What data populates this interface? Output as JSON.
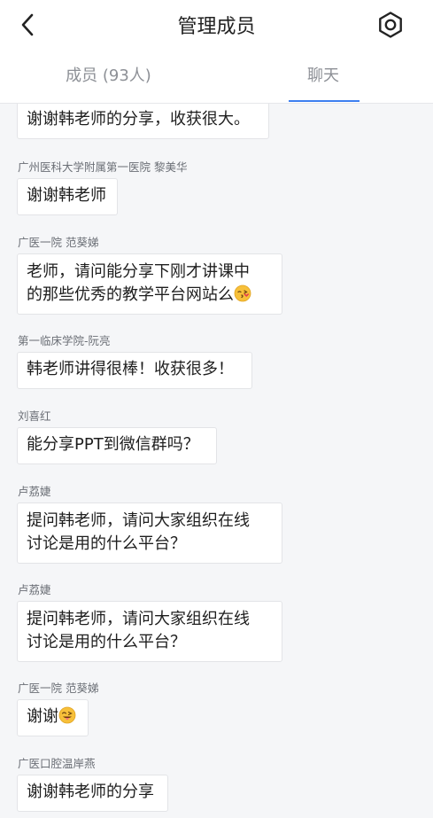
{
  "header": {
    "title": "管理成员",
    "back_icon": "chevron-left-icon",
    "settings_icon": "gear-icon"
  },
  "tabs": [
    {
      "label": "成员 (93人)",
      "active": false
    },
    {
      "label": "聊天",
      "active": true
    }
  ],
  "colors": {
    "accent": "#3d7ff0",
    "background": "#f5f6f8",
    "bubble_bg": "#ffffff",
    "text_muted": "#8d9096"
  },
  "messages": [
    {
      "sender": "",
      "text": "谢谢韩老师的分享，收获很大。"
    },
    {
      "sender": "广州医科大学附属第一医院 黎美华",
      "text": "谢谢韩老师"
    },
    {
      "sender": "广医一院 范葵娣",
      "line1": "老师，请问能分享下刚才讲课中",
      "line2": "的那些优秀的教学平台网站么",
      "emoji": "kissing-face-emoji"
    },
    {
      "sender": "第一临床学院-阮亮",
      "text": "韩老师讲得很棒！收获很多！"
    },
    {
      "sender": "刘喜红",
      "text": "能分享PPT到微信群吗？"
    },
    {
      "sender": "卢荔婕",
      "line1": "提问韩老师，请问大家组织在线",
      "line2": "讨论是用的什么平台？"
    },
    {
      "sender": "卢荔婕",
      "line1": "提问韩老师，请问大家组织在线",
      "line2": "讨论是用的什么平台？"
    },
    {
      "sender": "广医一院 范葵娣",
      "text": "谢谢",
      "emoji": "tongue-wink-emoji"
    },
    {
      "sender": "广医口腔温岸燕",
      "text": "谢谢韩老师的分享"
    }
  ]
}
